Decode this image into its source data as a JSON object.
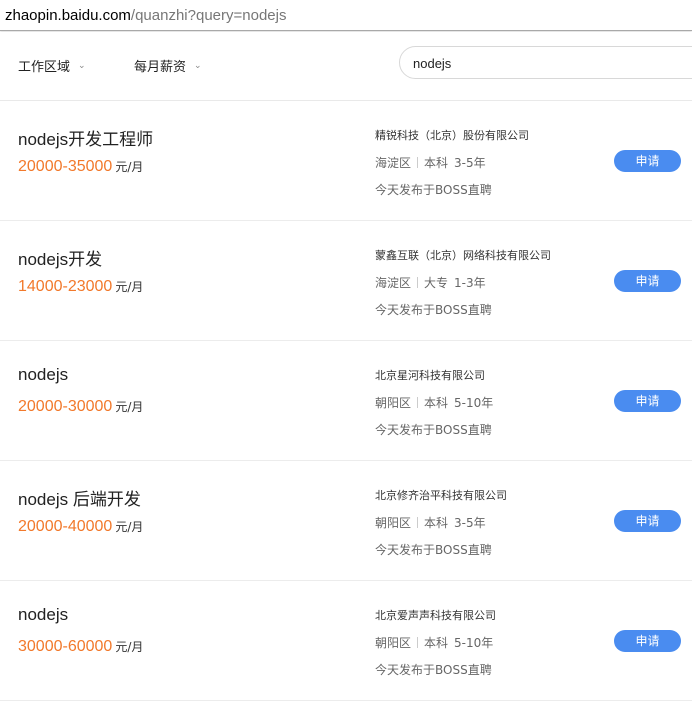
{
  "browser": {
    "url_host": "zhaopin.baidu.com",
    "url_path": "/quanzhi?query=nodejs"
  },
  "filters": {
    "area_label": "工作区域",
    "salary_label": "每月薪资"
  },
  "search": {
    "value": "nodejs"
  },
  "jobs": [
    {
      "title": "nodejs开发工程师",
      "salary": "20000-35000",
      "unit": "元/月",
      "company": "精锐科技（北京）股份有限公司",
      "district": "海淀区",
      "education": "本科",
      "experience": "3-5年",
      "source": "今天发布于BOSS直聘",
      "apply_label": "申请"
    },
    {
      "title": "nodejs开发",
      "salary": "14000-23000",
      "unit": "元/月",
      "company": "蒙鑫互联（北京）网络科技有限公司",
      "district": "海淀区",
      "education": "大专",
      "experience": "1-3年",
      "source": "今天发布于BOSS直聘",
      "apply_label": "申请"
    },
    {
      "title": "nodejs",
      "salary": "20000-30000",
      "unit": "元/月",
      "company": "北京星河科技有限公司",
      "district": "朝阳区",
      "education": "本科",
      "experience": "5-10年",
      "source": "今天发布于BOSS直聘",
      "apply_label": "申请"
    },
    {
      "title": "nodejs 后端开发",
      "salary": "20000-40000",
      "unit": "元/月",
      "company": "北京修齐治平科技有限公司",
      "district": "朝阳区",
      "education": "本科",
      "experience": "3-5年",
      "source": "今天发布于BOSS直聘",
      "apply_label": "申请"
    },
    {
      "title": "nodejs",
      "salary": "30000-60000",
      "unit": "元/月",
      "company": "北京爱声声科技有限公司",
      "district": "朝阳区",
      "education": "本科",
      "experience": "5-10年",
      "source": "今天发布于BOSS直聘",
      "apply_label": "申请"
    }
  ]
}
